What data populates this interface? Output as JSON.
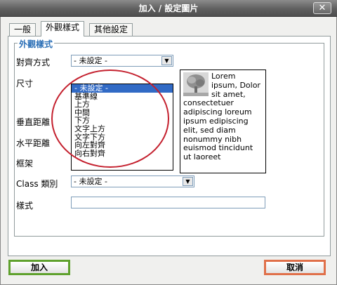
{
  "window": {
    "title": "加入 / 設定圖片",
    "close_label": "✕"
  },
  "tabs": [
    {
      "label": "一般"
    },
    {
      "label": "外觀樣式"
    },
    {
      "label": "其他設定"
    }
  ],
  "fieldset": {
    "legend": "外觀樣式"
  },
  "fields": {
    "align_label": "對齊方式",
    "align_value": "- 未設定 -",
    "size_label": "尺寸",
    "vspace_label": "垂直距離",
    "hspace_label": "水平距離",
    "border_label": "框架",
    "class_label": "Class 類別",
    "class_value": "- 未設定 -",
    "style_label": "樣式"
  },
  "align_options": [
    "- 未設定 -",
    "基準線",
    "上方",
    "中間",
    "下方",
    "文字上方",
    "文字下方",
    "向左對齊",
    "向右對齊"
  ],
  "preview_text": "Lorem ipsum, Dolor sit amet, consectetuer adipiscing loreum ipsum edipiscing elit, sed diam nonummy nibh euismod tincidunt ut laoreet",
  "buttons": {
    "insert": "加入",
    "cancel": "取消"
  },
  "colors": {
    "accent": "#2b6fb6",
    "highlight": "#316ac5",
    "annotation": "#c4202e"
  }
}
